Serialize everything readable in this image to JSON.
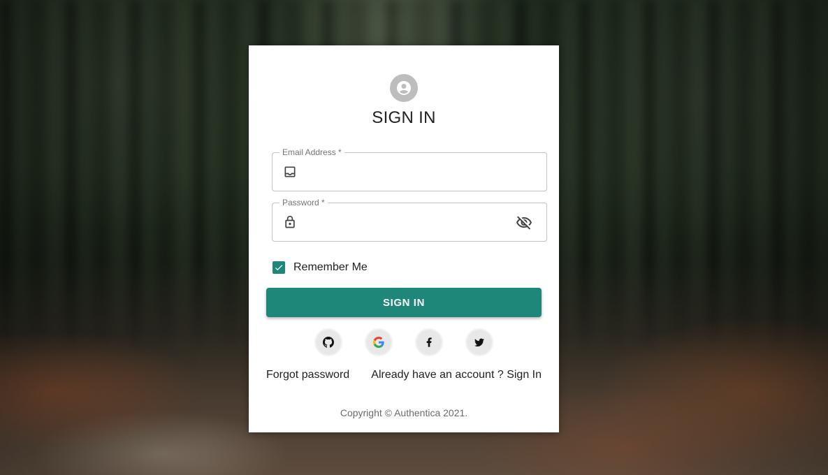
{
  "form": {
    "title": "SIGN IN",
    "email": {
      "label": "Email Address *",
      "value": "",
      "placeholder": ""
    },
    "password": {
      "label": "Password *",
      "value": "",
      "placeholder": ""
    },
    "remember_me": {
      "label": "Remember Me",
      "checked": true
    },
    "submit_label": "SIGN IN"
  },
  "social": [
    {
      "name": "github-icon"
    },
    {
      "name": "google-icon"
    },
    {
      "name": "facebook-icon"
    },
    {
      "name": "twitter-icon"
    }
  ],
  "links": {
    "forgot_password": "Forgot password",
    "already_have_account": "Already have an account ? Sign In"
  },
  "footer": {
    "copyright": "Copyright © Authentica 2021."
  },
  "colors": {
    "accent": "#1e877a",
    "avatar": "#bdbdbd",
    "border": "#c4c4c4"
  },
  "icons": {
    "avatar": "person-icon",
    "email": "inbox-icon",
    "password": "lock-icon",
    "toggle_visibility": "eye-off-icon"
  }
}
